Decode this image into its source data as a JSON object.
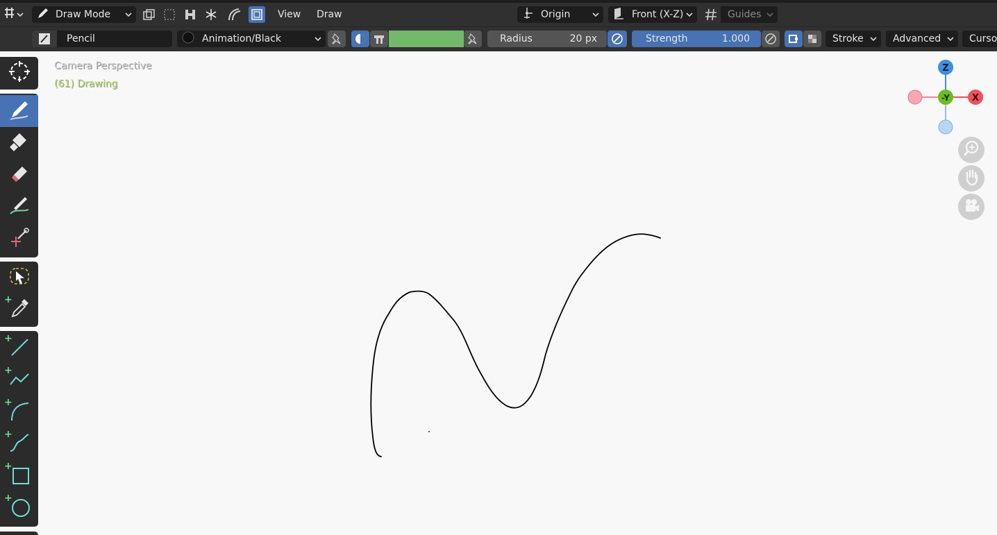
{
  "header": {
    "mode_label": "Draw Mode",
    "menu_view": "View",
    "menu_draw": "Draw",
    "pivot_label": "Origin",
    "orientation_label": "Front (X-Z)",
    "guides_label": "Guides"
  },
  "tool_settings": {
    "brush_name": "Pencil",
    "material_name": "Animation/Black",
    "color_swatch": "#73b86b",
    "radius_label": "Radius",
    "radius_value": "20 px",
    "strength_label": "Strength",
    "strength_value": "1.000",
    "stroke_menu": "Stroke",
    "advanced_menu": "Advanced",
    "cursor_menu": "Curso"
  },
  "viewport": {
    "view_name": "Camera Perspective",
    "object_info": "(61) Drawing",
    "stroke_color": "#000000",
    "background": "#f8f8f8"
  },
  "gizmo": {
    "z_label": "Z",
    "y_label": "-Y",
    "x_label": "X",
    "z_color": "#3f8fe0",
    "y_color": "#6cbe1d",
    "x_color": "#f0505f"
  },
  "toolbar": {
    "tools": [
      "cursor",
      "draw",
      "fill",
      "erase",
      "tint",
      "cutter",
      "select-box",
      "eyedropper",
      "line",
      "polyline",
      "arc",
      "curve",
      "box",
      "circle"
    ],
    "active_tool": "draw"
  },
  "navigation": [
    "zoom",
    "pan",
    "camera"
  ]
}
